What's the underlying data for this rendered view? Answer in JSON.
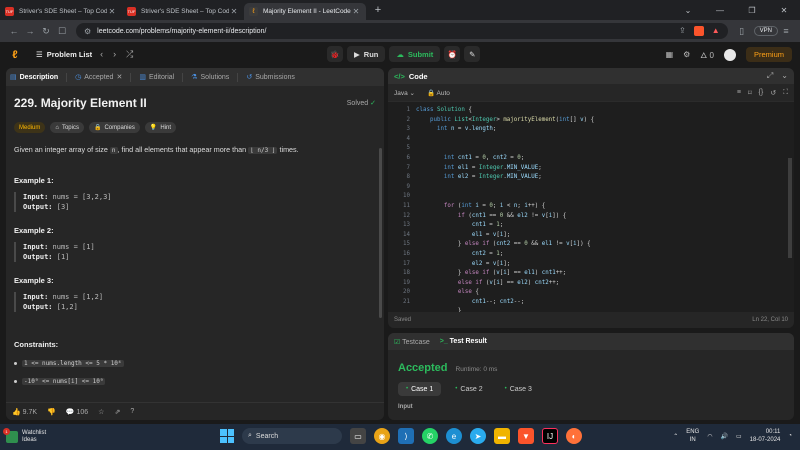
{
  "browser": {
    "tabs": [
      {
        "title": "Striver's SDE Sheet – Top Coding Inte",
        "favicon": "TUF"
      },
      {
        "title": "Striver's SDE Sheet – Top Coding Inte",
        "favicon": "TUF"
      },
      {
        "title": "Majority Element II - LeetCode",
        "favicon": "LC",
        "active": true
      }
    ],
    "url": "leetcode.com/problems/majority-element-ii/description/",
    "vpn_label": "VPN"
  },
  "lc_nav": {
    "problem_list": "Problem List",
    "run": "Run",
    "submit": "Submit",
    "streak": "0",
    "premium": "Premium"
  },
  "left_tabs": [
    "Description",
    "Accepted",
    "Editorial",
    "Solutions",
    "Submissions"
  ],
  "problem": {
    "title": "229. Majority Element II",
    "status": "Solved",
    "difficulty": "Medium",
    "chips": [
      "Topics",
      "Companies",
      "Hint"
    ],
    "desc_pre": "Given an integer array of size",
    "desc_n": "n",
    "desc_mid": ", find all elements that appear more than",
    "desc_code": "⌊ n/3 ⌋",
    "desc_post": "times.",
    "examples": [
      {
        "title": "Example 1:",
        "input": "nums = [3,2,3]",
        "output": "[3]"
      },
      {
        "title": "Example 2:",
        "input": "nums = [1]",
        "output": "[1]"
      },
      {
        "title": "Example 3:",
        "input": "nums = [1,2]",
        "output": "[1,2]"
      }
    ],
    "input_label": "Input:",
    "output_label": "Output:",
    "constraints_title": "Constraints:",
    "constraints": [
      "1 <= nums.length <= 5 * 10⁴",
      "-10⁹ <= nums[i] <= 10⁹"
    ],
    "likes": "9.7K",
    "comments": "106"
  },
  "code_panel": {
    "title": "Code",
    "language": "Java",
    "mode": "Auto",
    "status": "Saved",
    "cursor": "Ln 22, Col 10"
  },
  "result": {
    "tab_testcase": "Testcase",
    "tab_result": "Test Result",
    "verdict": "Accepted",
    "runtime": "Runtime: 0 ms",
    "cases": [
      "Case 1",
      "Case 2",
      "Case 3"
    ],
    "input_label": "Input"
  },
  "taskbar": {
    "weather_title": "Watchlist",
    "weather_sub": "Ideas",
    "weather_badge": "1",
    "search": "Search",
    "lang1": "ENG",
    "lang2": "IN",
    "time": "00:11",
    "date": "18-07-2024"
  }
}
